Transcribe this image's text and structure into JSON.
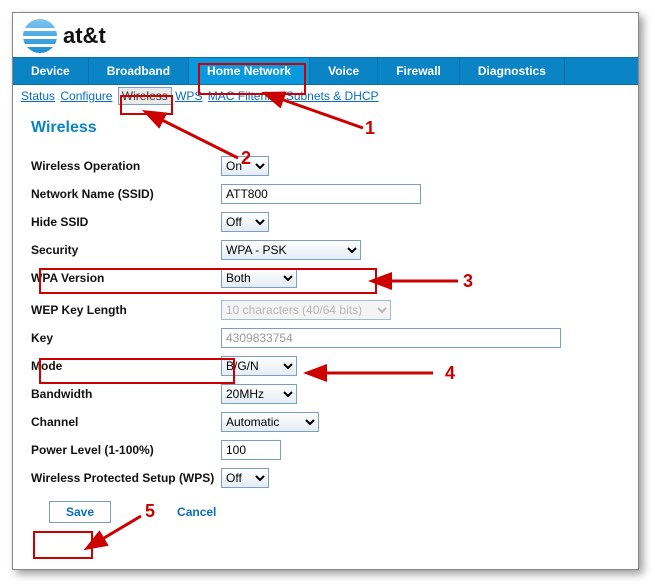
{
  "brand": "at&t",
  "nav": {
    "items": [
      "Device",
      "Broadband",
      "Home Network",
      "Voice",
      "Firewall",
      "Diagnostics"
    ],
    "active": 2
  },
  "subnav": {
    "items": [
      "Status",
      "Configure",
      "Wireless",
      "WPS",
      "MAC Filtering",
      "Subnets & DHCP"
    ],
    "selected": 2
  },
  "page_title": "Wireless",
  "form": {
    "wireless_operation": {
      "label": "Wireless Operation",
      "value": "On"
    },
    "ssid": {
      "label": "Network Name (SSID)",
      "value": "ATT800"
    },
    "hide_ssid": {
      "label": "Hide SSID",
      "value": "Off"
    },
    "security": {
      "label": "Security",
      "value": "WPA - PSK"
    },
    "wpa_version": {
      "label": "WPA Version",
      "value": "Both"
    },
    "wep_len": {
      "label": "WEP Key Length",
      "value": "10 characters (40/64 bits)"
    },
    "key": {
      "label": "Key",
      "value": "4309833754"
    },
    "mode": {
      "label": "Mode",
      "value": "B/G/N"
    },
    "bandwidth": {
      "label": "Bandwidth",
      "value": "20MHz"
    },
    "channel": {
      "label": "Channel",
      "value": "Automatic"
    },
    "power": {
      "label": "Power Level (1-100%)",
      "value": "100"
    },
    "wps": {
      "label": "Wireless Protected Setup (WPS)",
      "value": "Off"
    }
  },
  "buttons": {
    "save": "Save",
    "cancel": "Cancel"
  },
  "annotations": {
    "n1": "1",
    "n2": "2",
    "n3": "3",
    "n4": "4",
    "n5": "5"
  }
}
